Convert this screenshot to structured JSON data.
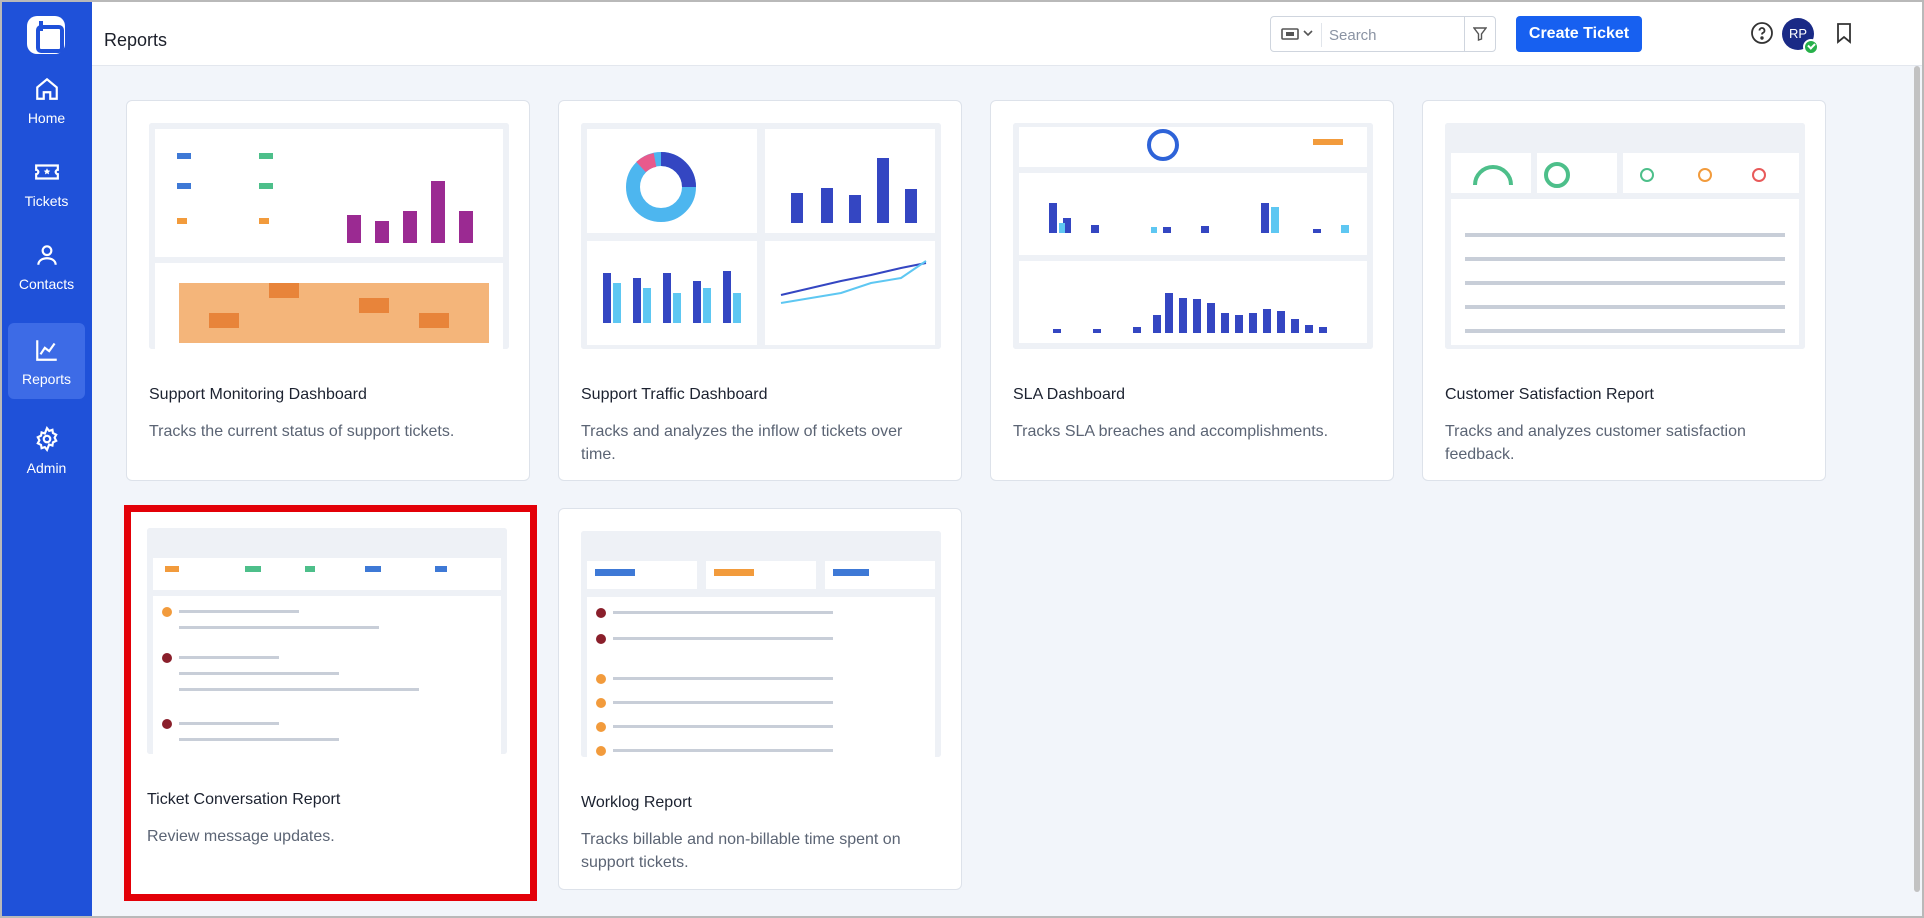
{
  "sidebar": {
    "logo": "helpdesk-logo",
    "items": [
      {
        "label": "Home",
        "icon": "home-icon",
        "active": false
      },
      {
        "label": "Tickets",
        "icon": "ticket-icon",
        "active": false
      },
      {
        "label": "Contacts",
        "icon": "person-icon",
        "active": false
      },
      {
        "label": "Reports",
        "icon": "chart-line-icon",
        "active": true
      },
      {
        "label": "Admin",
        "icon": "gear-icon",
        "active": false
      }
    ]
  },
  "header": {
    "title": "Reports",
    "search_placeholder": "Search",
    "create_button": "Create Ticket",
    "avatar_initials": "RP",
    "icons": [
      "help-icon",
      "megaphone-icon",
      "bookmark-icon"
    ]
  },
  "colors": {
    "sidebar": "#1f51d9",
    "primary_button": "#1760f0",
    "selection": "#e30008",
    "background": "#f2f5fa"
  },
  "reports": [
    {
      "title": "Support Monitoring Dashboard",
      "description": "Tracks the current status of support tickets.",
      "selected": false
    },
    {
      "title": "Support Traffic Dashboard",
      "description": "Tracks and analyzes the inflow of tickets over time.",
      "selected": false
    },
    {
      "title": "SLA Dashboard",
      "description": "Tracks SLA breaches and accomplishments.",
      "selected": false
    },
    {
      "title": "Customer Satisfaction Report",
      "description": "Tracks and analyzes customer satisfaction feedback.",
      "selected": false
    },
    {
      "title": "Ticket Conversation Report",
      "description": "Review message updates.",
      "selected": true
    },
    {
      "title": "Worklog Report",
      "description": "Tracks billable and non-billable time spent on support tickets.",
      "selected": false
    }
  ]
}
